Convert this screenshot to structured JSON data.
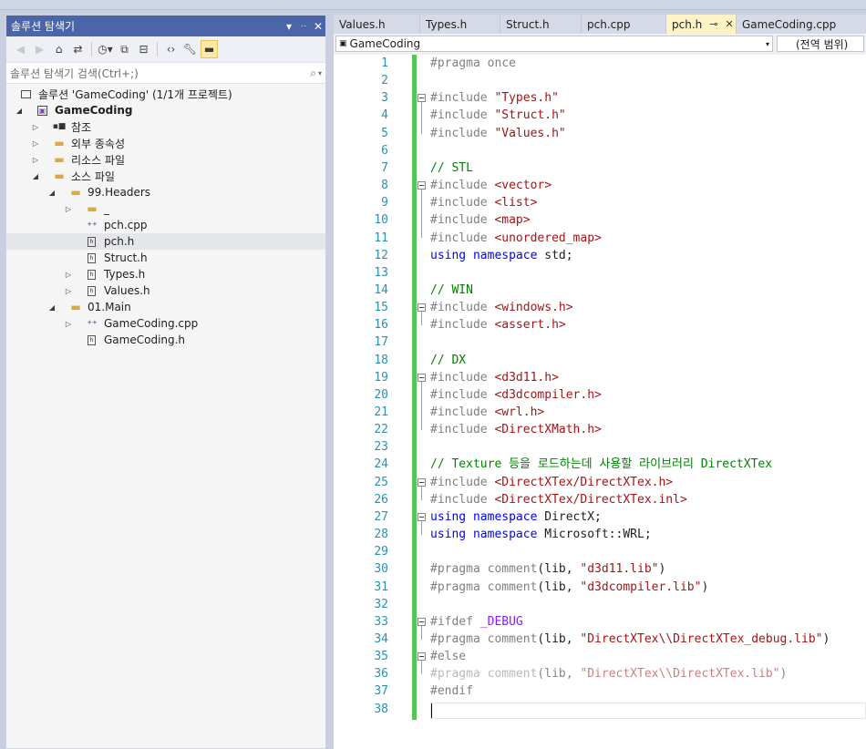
{
  "explorer": {
    "title": "솔루션 탐색기",
    "title_controls": [
      "▾",
      "ᵖ",
      "✕"
    ],
    "search_placeholder": "솔루션 탐색기 검색(Ctrl+;)",
    "search_icon": "⌕",
    "solution_label": "솔루션 'GameCoding' (1/1개 프로젝트)",
    "project_label": "GameCoding",
    "tree": [
      {
        "label": "참조",
        "icon": "references-icon",
        "glyph": "▪■"
      },
      {
        "label": "외부 종속성",
        "icon": "folder-icon",
        "glyph": "▬"
      },
      {
        "label": "리소스 파일",
        "icon": "filter-folder-icon",
        "glyph": "▬"
      },
      {
        "label": "소스 파일",
        "icon": "filter-folder-icon",
        "glyph": "▬"
      },
      {
        "label": "99.Headers",
        "icon": "filter-folder-icon",
        "glyph": "▬"
      },
      {
        "label": "_",
        "icon": "filter-folder-icon",
        "glyph": "▬"
      },
      {
        "label": "pch.cpp",
        "icon": "cpp-file-icon",
        "glyph": "⁺⁺"
      },
      {
        "label": "pch.h",
        "icon": "header-file-icon",
        "glyph": "h"
      },
      {
        "label": "Struct.h",
        "icon": "header-file-icon",
        "glyph": "h"
      },
      {
        "label": "Types.h",
        "icon": "header-file-icon",
        "glyph": "h"
      },
      {
        "label": "Values.h",
        "icon": "header-file-icon",
        "glyph": "h"
      },
      {
        "label": "01.Main",
        "icon": "filter-folder-icon",
        "glyph": "▬"
      },
      {
        "label": "GameCoding.cpp",
        "icon": "cpp-file-icon",
        "glyph": "⁺⁺"
      },
      {
        "label": "GameCoding.h",
        "icon": "header-file-icon",
        "glyph": "h"
      }
    ]
  },
  "editor": {
    "tabs": [
      {
        "label": "Values.h"
      },
      {
        "label": "Types.h"
      },
      {
        "label": "Struct.h"
      },
      {
        "label": "pch.cpp"
      },
      {
        "label": "pch.h",
        "pin": "⊸",
        "close": "✕"
      },
      {
        "label": "GameCoding.cpp"
      }
    ],
    "project_combo": "GameCoding",
    "scope_combo": "(전역 범위)",
    "lines": [
      {
        "n": "1",
        "t": "#pragma once"
      },
      {
        "n": "2",
        "t": ""
      },
      {
        "n": "3",
        "t": "#include \"Types.h\""
      },
      {
        "n": "4",
        "t": "#include \"Struct.h\""
      },
      {
        "n": "5",
        "t": "#include \"Values.h\""
      },
      {
        "n": "6",
        "t": ""
      },
      {
        "n": "7",
        "t": "// STL"
      },
      {
        "n": "8",
        "t": "#include <vector>"
      },
      {
        "n": "9",
        "t": "#include <list>"
      },
      {
        "n": "10",
        "t": "#include <map>"
      },
      {
        "n": "11",
        "t": "#include <unordered_map>"
      },
      {
        "n": "12",
        "t": "using namespace std;"
      },
      {
        "n": "13",
        "t": ""
      },
      {
        "n": "14",
        "t": "// WIN"
      },
      {
        "n": "15",
        "t": "#include <windows.h>"
      },
      {
        "n": "16",
        "t": "#include <assert.h>"
      },
      {
        "n": "17",
        "t": ""
      },
      {
        "n": "18",
        "t": "// DX"
      },
      {
        "n": "19",
        "t": "#include <d3d11.h>"
      },
      {
        "n": "20",
        "t": "#include <d3dcompiler.h>"
      },
      {
        "n": "21",
        "t": "#include <wrl.h>"
      },
      {
        "n": "22",
        "t": "#include <DirectXMath.h>"
      },
      {
        "n": "23",
        "t": ""
      },
      {
        "n": "24",
        "t": "// Texture 등을 로드하는데 사용할 라이브러리 DirectXTex"
      },
      {
        "n": "25",
        "t": "#include <DirectXTex/DirectXTex.h>"
      },
      {
        "n": "26",
        "t": "#include <DirectXTex/DirectXTex.inl>"
      },
      {
        "n": "27",
        "t": "using namespace DirectX;"
      },
      {
        "n": "28",
        "t": "using namespace Microsoft::WRL;"
      },
      {
        "n": "29",
        "t": ""
      },
      {
        "n": "30",
        "t": "#pragma comment(lib, \"d3d11.lib\")"
      },
      {
        "n": "31",
        "t": "#pragma comment(lib, \"d3dcompiler.lib\")"
      },
      {
        "n": "32",
        "t": ""
      },
      {
        "n": "33",
        "t": "#ifdef _DEBUG"
      },
      {
        "n": "34",
        "t": "#pragma comment(lib, \"DirectXTex\\\\DirectXTex_debug.lib\")"
      },
      {
        "n": "35",
        "t": "#else"
      },
      {
        "n": "36",
        "t": "#pragma comment(lib, \"DirectXTex\\\\DirectXTex.lib\")"
      },
      {
        "n": "37",
        "t": "#endif"
      },
      {
        "n": "38",
        "t": ""
      }
    ]
  }
}
